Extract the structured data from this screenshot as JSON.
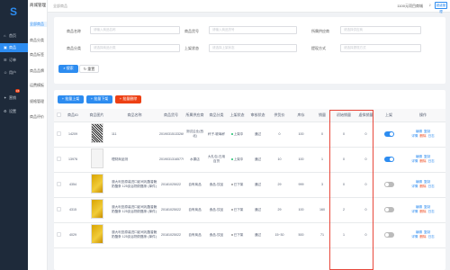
{
  "nav": {
    "items": [
      {
        "label": "首页",
        "icon": "home-icon",
        "active": false
      },
      {
        "label": "商品",
        "icon": "goods-icon",
        "active": true
      },
      {
        "label": "订单",
        "icon": "order-icon",
        "active": false
      },
      {
        "label": "用户",
        "icon": "user-icon",
        "active": false
      },
      {
        "label": "营销",
        "icon": "marketing-icon",
        "active": false
      },
      {
        "label": "设置",
        "icon": "settings-icon",
        "active": false
      }
    ],
    "badge": "15"
  },
  "sub": {
    "title": "商城管理",
    "items": [
      "全部商品",
      "商品分类",
      "商品标签",
      "商品品牌",
      "运费模板",
      "规格管理",
      "商品评价",
      "商品回收站"
    ]
  },
  "top": {
    "crumb": "全部商品",
    "info": "1100元项目商城",
    "user": "超级管理"
  },
  "filters": {
    "labels": [
      "商品名称",
      "商品货号",
      "所属供应商",
      "商品分类",
      "上架状态",
      "提现方式"
    ],
    "placeholders": [
      "请输入商品名称",
      "请输入商品货号",
      "请选择供应商",
      "请选择商品分类",
      "请选择上架状态",
      "请选择提现方式"
    ],
    "search": "搜索",
    "reset": "重置"
  },
  "actions": {
    "batch_on": "批量上架",
    "batch_off": "批量下架",
    "batch_delete": "批量删除"
  },
  "table": {
    "headers": [
      "",
      "商品ID",
      "商品图片",
      "商品名称",
      "商品货号",
      "所属供应商",
      "商品分类",
      "上架状态",
      "审核状态",
      "供货价",
      "库存",
      "销量",
      "初始销量",
      "虚拟销量",
      "上架",
      "操作"
    ],
    "rows": [
      {
        "id": "14209",
        "img": "q",
        "name": "111",
        "sku": "20190315133269",
        "supplier": "测试企业(西北)",
        "category": "杯子-玻璃杯",
        "status": "上架中",
        "audit": "通过",
        "price": "0",
        "stock": "100",
        "sales": "0",
        "init": "0",
        "virtual": "0",
        "on": true
      },
      {
        "id": "13976",
        "img": "w",
        "name": "理财商品测",
        "sku": "20190313165779",
        "supplier": "水果店",
        "category": "大礼包-日用百货",
        "status": "上架中",
        "audit": "通过",
        "price": "10",
        "stock": "100",
        "sales": "1",
        "init": "0",
        "virtual": "0",
        "on": true
      },
      {
        "id": "4354",
        "img": "g",
        "name": "澳大利亚原装进口起司乳酪香脆奶酪条 125克谷物奶酪条 (单件)",
        "sku": "20181025022",
        "supplier": "自有商品",
        "category": "食品-饮品",
        "status": "已下架",
        "audit": "通过",
        "price": "29",
        "stock": "999",
        "sales": "3",
        "init": "0",
        "virtual": "0",
        "on": false
      },
      {
        "id": "4315",
        "img": "g",
        "name": "澳大利亚原装进口起司乳酪香脆奶酪条 125克谷物奶酪条 (单件)",
        "sku": "20181025022",
        "supplier": "自有商品",
        "category": "食品-饮品",
        "status": "已下架",
        "audit": "通过",
        "price": "29",
        "stock": "100",
        "sales": "160",
        "init": "2",
        "virtual": "0",
        "on": false
      },
      {
        "id": "4029",
        "img": "g",
        "name": "澳大利亚原装进口起司乳酪香脆奶酪条 125克谷物奶酪条 (单件)",
        "sku": "20181025022",
        "supplier": "自有商品",
        "category": "食品-饮品",
        "status": "已下架",
        "audit": "通过",
        "price": "15~30",
        "stock": "500",
        "sales": "71",
        "init": "1",
        "virtual": "0",
        "on": false
      }
    ],
    "ops": {
      "edit": "编辑",
      "copy": "复制",
      "detail": "详情",
      "delete": "删除",
      "log": "日志"
    }
  },
  "colors": {
    "accent": "#2d8cf0",
    "danger": "#ed4014",
    "nav_bg": "#1e2a3a",
    "highlight": "#e8483b"
  }
}
